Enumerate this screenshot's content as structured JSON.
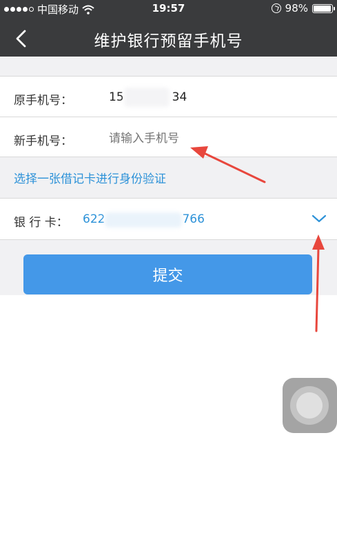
{
  "status_bar": {
    "carrier": "中国移动",
    "time": "19:57",
    "battery_percent": "98%",
    "battery_level": 0.98,
    "icons": [
      "signal-dots-icon",
      "wifi-icon",
      "orientation-lock-icon",
      "battery-icon"
    ]
  },
  "nav": {
    "back_icon": "chevron-left-icon",
    "title": "维护银行预留手机号"
  },
  "form": {
    "original_phone": {
      "label": "原手机号：",
      "value_prefix": "15",
      "value_suffix": "34"
    },
    "new_phone": {
      "label": "新手机号：",
      "placeholder": "请输入手机号"
    },
    "verify_link": "选择一张借记卡进行身份验证",
    "bank_card": {
      "label": "银 行 卡：",
      "value_prefix": "622",
      "value_suffix": "766",
      "dropdown_icon": "chevron-down-icon"
    }
  },
  "submit_label": "提交",
  "colors": {
    "nav_bg": "#3a3b3d",
    "accent_blue": "#2d92d8",
    "button_blue": "#4498e8",
    "annotation_red": "#e8473d"
  }
}
